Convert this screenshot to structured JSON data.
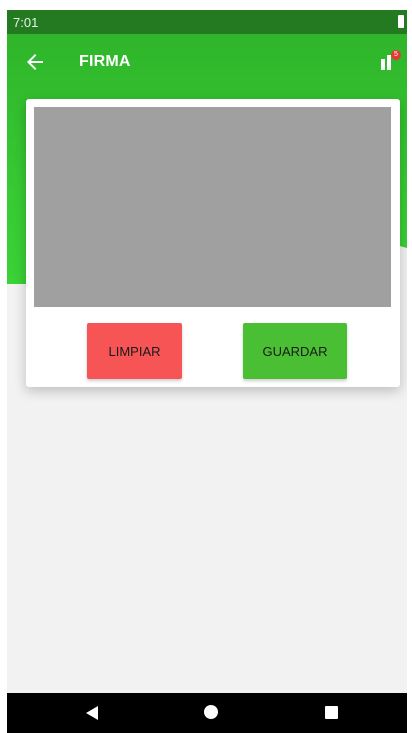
{
  "status_bar": {
    "time": "7:01"
  },
  "app_bar": {
    "title": "FIRMA",
    "notification_count": "5"
  },
  "actions": {
    "clear_label": "LIMPIAR",
    "save_label": "GUARDAR"
  },
  "colors": {
    "primary": "#2fb52a",
    "clear_button": "#f75555",
    "save_button": "#4abf33",
    "signature_pad": "#a0a0a0"
  },
  "icons": {
    "back": "arrow-left-icon",
    "notifications": "signal-notification-icon",
    "nav_back": "triangle-back-icon",
    "nav_home": "circle-home-icon",
    "nav_recent": "square-recent-icon"
  }
}
